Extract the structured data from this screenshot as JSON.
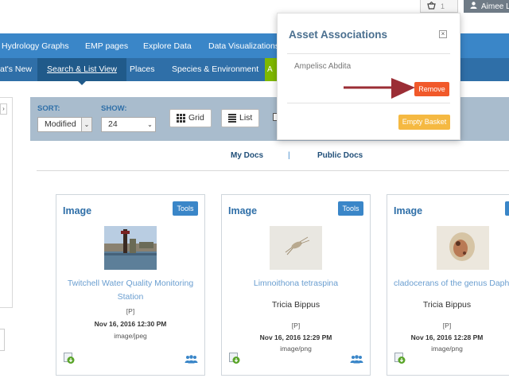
{
  "header": {
    "basket_count": "1",
    "user_name": "Aimee L"
  },
  "nav_primary": [
    "Hydrology Graphs",
    "EMP pages",
    "Explore Data",
    "Data Visualizations"
  ],
  "nav_secondary": [
    {
      "label": "at's New",
      "active": false
    },
    {
      "label": "Search & List View",
      "active": true
    },
    {
      "label": "Places",
      "active": false
    },
    {
      "label": "Species & Environment",
      "active": false
    },
    {
      "label": "A",
      "active": false
    }
  ],
  "toolbar": {
    "sort_label": "SORT:",
    "sort_value": "Modified",
    "show_label": "SHOW:",
    "show_value": "24",
    "grid_label": "Grid",
    "list_label": "List"
  },
  "doc_tabs": {
    "my_docs": "My Docs",
    "separator": "|",
    "public_docs": "Public Docs"
  },
  "cards": [
    {
      "type": "Image",
      "tools": "Tools",
      "title_line1": "Twitchell Water Quality Monitoring",
      "title_line2": "Station",
      "author": "",
      "flag": "[P]",
      "date": "Nov 16, 2016 12:30 PM",
      "mime": "image/jpeg",
      "thumb": "water-station-photo"
    },
    {
      "type": "Image",
      "tools": "Tools",
      "title_line1": "Limnoithona tetraspina",
      "title_line2": "",
      "author": "Tricia Bippus",
      "flag": "[P]",
      "date": "Nov 16, 2016 12:29 PM",
      "mime": "image/png",
      "thumb": "copepod-photo"
    },
    {
      "type": "Image",
      "tools": "T",
      "title_line1": "cladocerans of the genus Daph",
      "title_line2": "",
      "author": "Tricia Bippus",
      "flag": "[P]",
      "date": "Nov 16, 2016 12:28 PM",
      "mime": "image/png",
      "thumb": "cladoceran-photo"
    }
  ],
  "popup": {
    "title": "Asset Associations",
    "close": "×",
    "asset_name": "Ampelisc Abdita",
    "remove_label": "Remove",
    "empty_label": "Empty Basket"
  },
  "colors": {
    "nav_primary": "#3a86c8",
    "nav_secondary": "#2f6fa8",
    "toolbar": "#a9bccd",
    "remove": "#f1592a",
    "empty_basket": "#f5b942",
    "annotation_arrow": "#9b2d35"
  }
}
